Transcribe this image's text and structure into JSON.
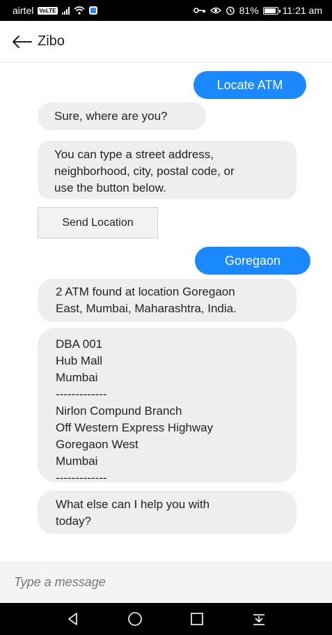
{
  "status_bar": {
    "carrier": "airtel",
    "volte": "VoLTE",
    "battery": "81%",
    "time": "11:21 am"
  },
  "header": {
    "title": "Zibo"
  },
  "messages": [
    {
      "sender": "user",
      "text": "Locate ATM"
    },
    {
      "sender": "bot",
      "text": "Sure, where are you?"
    },
    {
      "sender": "bot",
      "lines": [
        "You can type a street address,",
        "neighborhood, city, postal code, or",
        "use the button below."
      ]
    },
    {
      "sender": "bot_button",
      "text": "Send Location"
    },
    {
      "sender": "user",
      "text": "Goregaon"
    },
    {
      "sender": "bot",
      "lines": [
        "2 ATM found at location Goregaon",
        "East, Mumbai, Maharashtra, India."
      ]
    },
    {
      "sender": "bot",
      "lines": [
        "DBA 001",
        "Hub Mall",
        "Mumbai",
        "-------------",
        "Nirlon Compund Branch",
        "Off Western Express Highway",
        "Goregaon West",
        "Mumbai",
        "-------------"
      ]
    },
    {
      "sender": "bot",
      "lines": [
        "What else can I help you with",
        "today?"
      ]
    }
  ],
  "composer": {
    "placeholder": "Type a message"
  },
  "colors": {
    "user_bubble": "#1a88ff",
    "bot_bubble": "#eeeeee"
  }
}
